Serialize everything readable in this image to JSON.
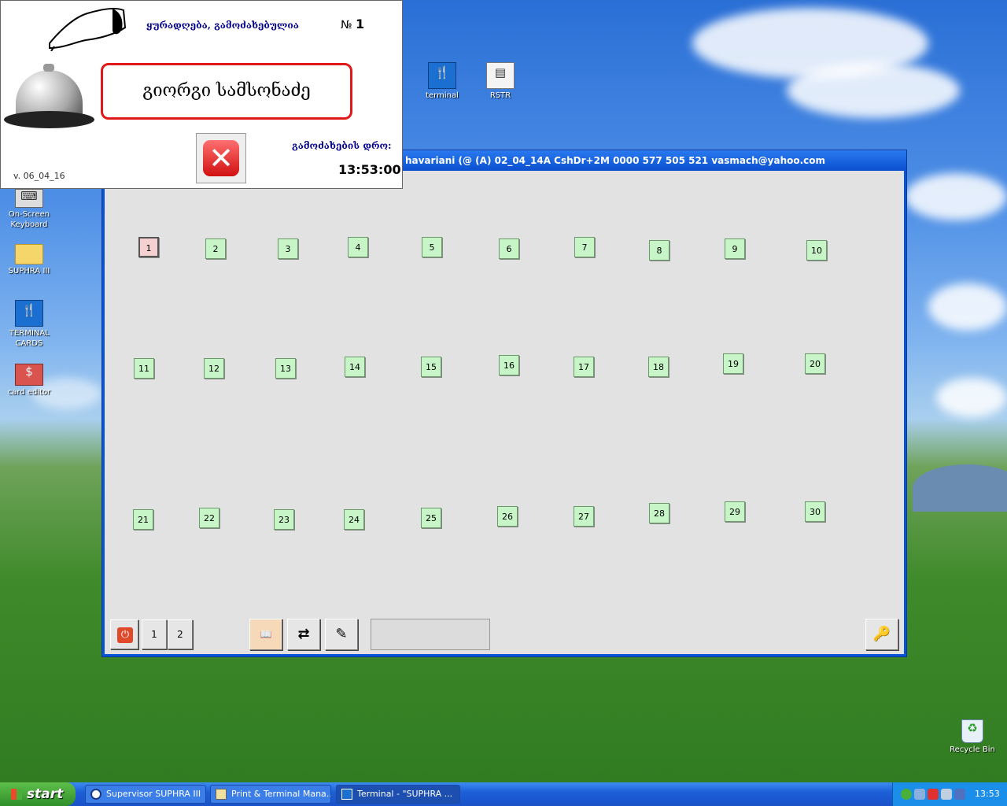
{
  "desktop": {
    "icons": [
      {
        "label": "terminal",
        "icon": "restaurant-icon"
      },
      {
        "label": "RSTR",
        "icon": "document-icon"
      },
      {
        "label": "On-Screen Keyboard",
        "icon": "keyboard-icon"
      },
      {
        "label": "SUPHRA III",
        "icon": "folder-icon"
      },
      {
        "label": "TERMINAL CARDS",
        "icon": "restaurant-icon"
      },
      {
        "label": "card editor",
        "icon": "card-icon"
      },
      {
        "label": "Recycle Bin",
        "icon": "recycle-bin-icon"
      }
    ],
    "terminal_glyph": "🍴",
    "rstr_glyph": "▤",
    "kbd_glyph": "⌨",
    "folder_glyph": "",
    "cards_glyph": "🍴",
    "card_glyph": "$",
    "bin_glyph": "♻"
  },
  "main_window": {
    "title": "havariani (@ (A) 02_04_14A CshDr+2M 0000 577 505 521 vasmach@yahoo.com",
    "tables": [
      "1",
      "2",
      "3",
      "4",
      "5",
      "6",
      "7",
      "8",
      "9",
      "10",
      "11",
      "12",
      "13",
      "14",
      "15",
      "16",
      "17",
      "18",
      "19",
      "20",
      "21",
      "22",
      "23",
      "24",
      "25",
      "26",
      "27",
      "28",
      "29",
      "30"
    ],
    "selected_table": "1",
    "power_glyph": "⏻",
    "page_buttons": [
      "1",
      "2"
    ],
    "book_glyph": "📖",
    "transfer_glyph": "⇄",
    "edit_glyph": "✎",
    "key_glyph": "🔑"
  },
  "popup": {
    "title": "ყურადღება, გამოძახებულია",
    "number_prefix": "№",
    "number": "1",
    "name": "გიორგი სამსონაძე",
    "close_glyph": "✕",
    "time_label": "გამოძახების დრო:",
    "time": "13:53:00",
    "version": "v. 06_04_16"
  },
  "taskbar": {
    "start_label": "start",
    "tasks": [
      {
        "label": "Supervisor SUPHRA III",
        "icon": "eye-icon",
        "active": false
      },
      {
        "label": "Print & Terminal Mana...",
        "icon": "printer-icon",
        "active": false
      },
      {
        "label": "Terminal - \"SUPHRA ...",
        "icon": "restaurant-icon",
        "active": true
      }
    ],
    "clock": "13:53"
  },
  "colors": {
    "table_free": "#c8f5c8",
    "table_selected": "#f5d0d0",
    "popup_border": "#e01818",
    "popup_text": "#00008b"
  }
}
